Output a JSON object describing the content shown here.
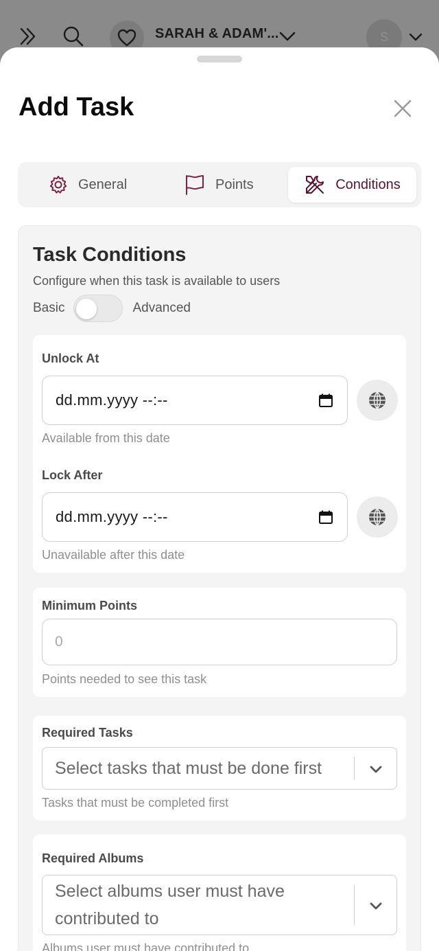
{
  "topbar": {
    "title": "SARAH & ADAM'...",
    "avatar_initial": "S",
    "icons": [
      "double-chevron-right-icon",
      "search-icon",
      "heart-icon",
      "chevron-down-icon",
      "chevron-down-icon"
    ]
  },
  "sheet": {
    "title": "Add Task"
  },
  "tabs": [
    {
      "label": "General",
      "icon": "gear-icon"
    },
    {
      "label": "Points",
      "icon": "flag-icon"
    },
    {
      "label": "Conditions",
      "icon": "tools-icon",
      "active": true
    }
  ],
  "conditions": {
    "title": "Task Conditions",
    "subtitle": "Configure when this task is available to users",
    "toggle": {
      "left_label": "Basic",
      "right_label": "Advanced",
      "checked": false
    },
    "unlock": {
      "label": "Unlock At",
      "value": "dd.mm.yyyy --:--",
      "helper": "Available from this date"
    },
    "lock": {
      "label": "Lock After",
      "value": "dd.mm.yyyy --:--",
      "helper": "Unavailable after this date"
    },
    "min_points": {
      "label": "Minimum Points",
      "placeholder": "0",
      "helper": "Points needed to see this task"
    },
    "required_tasks": {
      "label": "Required Tasks",
      "placeholder": "Select tasks that must be done first",
      "helper": "Tasks that must be completed first"
    },
    "required_albums": {
      "label": "Required Albums",
      "placeholder_line1": "Select albums user must have",
      "placeholder_line2": "contributed to",
      "helper": "Albums user must have contributed to"
    }
  },
  "colors": {
    "accent": "#5b1230",
    "overlay": "#7a7a7a",
    "panel_bg": "#f4f4f4",
    "tabs_bg": "#f3f3f3"
  }
}
